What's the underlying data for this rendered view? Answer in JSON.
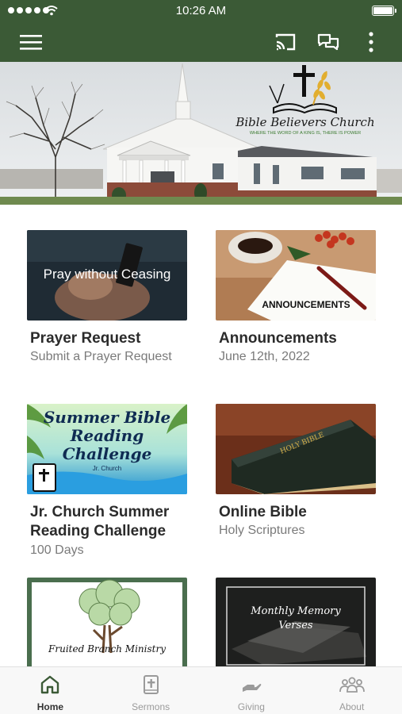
{
  "status_bar": {
    "time": "10:26 AM"
  },
  "app_bar": {
    "icons": [
      "menu-icon",
      "cast-icon",
      "chat-icon",
      "more-vertical-icon"
    ]
  },
  "hero": {
    "logo_title": "Bible Believers Church",
    "logo_tagline": "WHERE THE WORD OF A KING IS, THERE IS POWER"
  },
  "cards": [
    {
      "image_caption": "Pray without Ceasing",
      "title": "Prayer Request",
      "subtitle": "Submit a Prayer Request"
    },
    {
      "image_caption": "ANNOUNCEMENTS",
      "title": "Announcements",
      "subtitle": "June 12th, 2022"
    },
    {
      "image_caption_lines": [
        "Summer Bible",
        "Reading",
        "Challenge"
      ],
      "image_caption_small": "Jr. Church",
      "title_lines": [
        "Jr. Church Summer",
        "Reading Challenge"
      ],
      "subtitle": "100 Days"
    },
    {
      "image_caption": "HOLY BIBLE",
      "title": "Online Bible",
      "subtitle": "Holy Scriptures"
    },
    {
      "image_caption": "Fruited Branch Ministry"
    },
    {
      "image_caption_lines": [
        "Monthly Memory",
        "Verses"
      ]
    }
  ],
  "tabs": [
    {
      "label": "Home",
      "icon": "home-icon",
      "active": true
    },
    {
      "label": "Sermons",
      "icon": "bible-icon",
      "active": false
    },
    {
      "label": "Giving",
      "icon": "giving-hand-icon",
      "active": false
    },
    {
      "label": "About",
      "icon": "people-icon",
      "active": false
    }
  ],
  "colors": {
    "primary": "#3b5a36",
    "tab_bg": "#f8f8f8"
  }
}
